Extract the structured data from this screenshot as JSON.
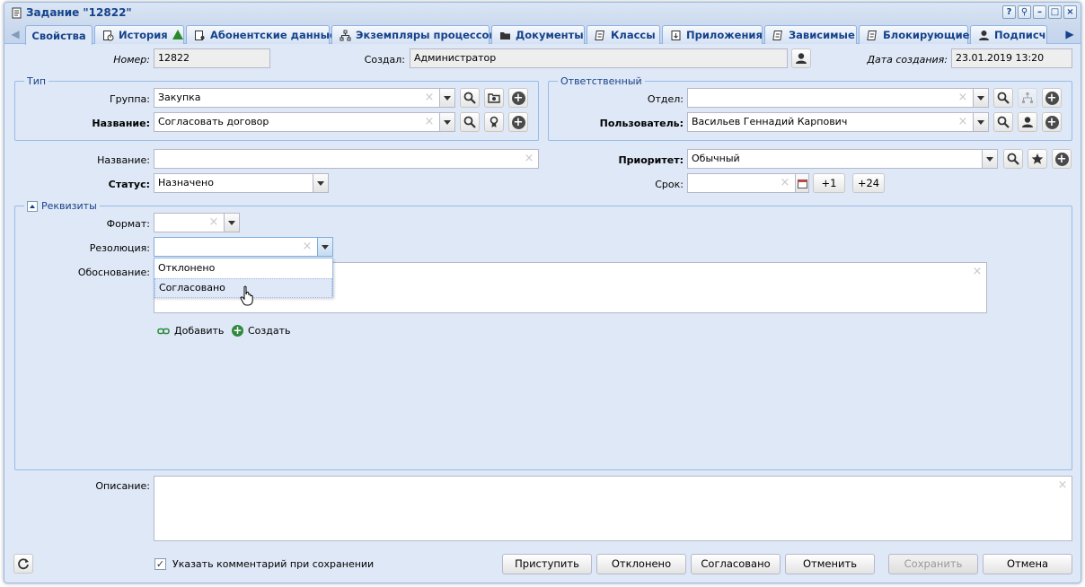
{
  "window": {
    "title": "Задание \"12822\"",
    "tools": [
      "?",
      "⚲",
      "–",
      "□",
      "×"
    ]
  },
  "tabs": [
    {
      "label": "Свойства",
      "icon": "none"
    },
    {
      "label": "История",
      "icon": "history-icon"
    },
    {
      "label": "Абонентские данные",
      "icon": "document-user-icon"
    },
    {
      "label": "Экземпляры процессов",
      "icon": "process-tree-icon"
    },
    {
      "label": "Документы",
      "icon": "folder-icon"
    },
    {
      "label": "Классы",
      "icon": "class-icon"
    },
    {
      "label": "Приложения",
      "icon": "attachment-icon"
    },
    {
      "label": "Зависимые",
      "icon": "dependent-icon"
    },
    {
      "label": "Блокирующие",
      "icon": "blocking-icon"
    },
    {
      "label": "Подписчи",
      "icon": "user-icon"
    }
  ],
  "header": {
    "number_label": "Номер:",
    "number_value": "12822",
    "creator_label": "Создал:",
    "creator_value": "Администратор",
    "created_label": "Дата создания:",
    "created_value": "23.01.2019 13:20"
  },
  "type_group": {
    "legend": "Тип",
    "group_label": "Группа:",
    "group_value": "Закупка",
    "name_label": "Название:",
    "name_value": "Согласовать договор"
  },
  "responsible_group": {
    "legend": "Ответственный",
    "dept_label": "Отдел:",
    "dept_value": "",
    "user_label": "Пользователь:",
    "user_value": "Васильев Геннадий Карпович"
  },
  "main": {
    "title_label": "Название:",
    "title_value": "",
    "priority_label": "Приоритет:",
    "priority_value": "Обычный",
    "status_label": "Статус:",
    "status_value": "Назначено",
    "deadline_label": "Срок:",
    "deadline_value": "",
    "plus1": "+1",
    "plus24": "+24"
  },
  "details": {
    "legend": "Реквизиты",
    "format_label": "Формат:",
    "format_value": "",
    "resolution_label": "Резолюция:",
    "resolution_value": "",
    "resolution_options": [
      "Отклонено",
      "Согласовано"
    ],
    "reason_label": "Обоснование:",
    "add_link": "Добавить",
    "create_link": "Создать"
  },
  "description": {
    "label": "Описание:"
  },
  "footer": {
    "comment_checkbox": "Указать комментарий при сохранении",
    "comment_checked": true,
    "buttons": [
      "Приступить",
      "Отклонено",
      "Согласовано",
      "Отменить",
      "Сохранить",
      "Отмена"
    ]
  }
}
